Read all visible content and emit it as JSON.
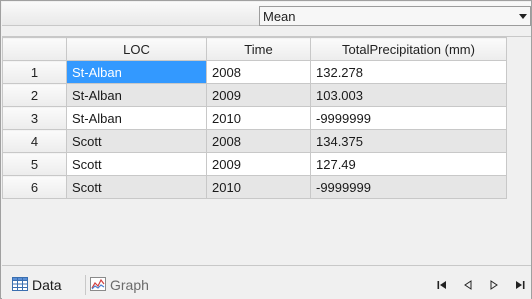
{
  "toolbar": {
    "aggregation": {
      "selected": "Mean"
    }
  },
  "grid": {
    "columns": [
      "LOC",
      "Time",
      "TotalPrecipitation (mm)"
    ],
    "rows": [
      {
        "num": "1",
        "loc": "St-Alban",
        "time": "2008",
        "value": "132.278"
      },
      {
        "num": "2",
        "loc": "St-Alban",
        "time": "2009",
        "value": "103.003"
      },
      {
        "num": "3",
        "loc": "St-Alban",
        "time": "2010",
        "value": "-9999999"
      },
      {
        "num": "4",
        "loc": "Scott",
        "time": "2008",
        "value": "134.375"
      },
      {
        "num": "5",
        "loc": "Scott",
        "time": "2009",
        "value": "127.49"
      },
      {
        "num": "6",
        "loc": "Scott",
        "time": "2010",
        "value": "-9999999"
      }
    ]
  },
  "tabs": {
    "data_label": "Data",
    "graph_label": "Graph"
  },
  "colors": {
    "selection": "#3399ff",
    "alt_row": "#e6e6e6"
  }
}
